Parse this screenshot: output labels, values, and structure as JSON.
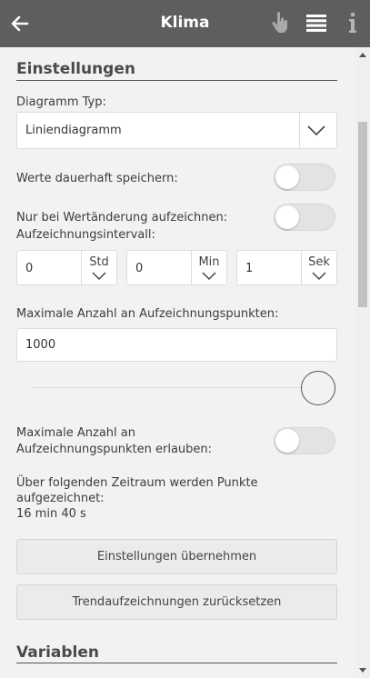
{
  "header": {
    "title": "Klima",
    "back_icon": "arrow-left-icon",
    "hand_icon": "hand-pointer-icon",
    "list_icon": "list-icon",
    "info_icon": "info-icon"
  },
  "settings": {
    "section_title": "Einstellungen",
    "diagram_type_label": "Diagramm Typ:",
    "diagram_type_value": "Liniendiagramm",
    "persist_label": "Werte dauerhaft speichern:",
    "persist_on": false,
    "record_on_change_label": "Nur bei Wertänderung aufzeichnen:",
    "record_on_change_on": false,
    "interval_label": "Aufzeichnungsintervall:",
    "interval": {
      "hours_value": "0",
      "hours_unit": "Std",
      "minutes_value": "0",
      "minutes_unit": "Min",
      "seconds_value": "1",
      "seconds_unit": "Sek"
    },
    "max_points_label": "Maximale Anzahl an Aufzeichnungspunkten:",
    "max_points_value": "1000",
    "max_points_slider_fraction": 1.0,
    "allow_max_points_label_line1": "Maximale Anzahl an",
    "allow_max_points_label_line2": "Aufzeichnungspunkten erlauben:",
    "allow_max_points_on": false,
    "timespan_line1": "Über folgenden Zeitraum werden Punkte",
    "timespan_line2": "aufgezeichnet:",
    "timespan_value": "16 min 40 s",
    "apply_button": "Einstellungen übernehmen",
    "reset_button": "Trendaufzeichnungen zurücksetzen"
  },
  "variables": {
    "section_title": "Variablen"
  },
  "colors": {
    "header_bg": "#5e5e5e",
    "page_bg": "#f2f2f2"
  }
}
